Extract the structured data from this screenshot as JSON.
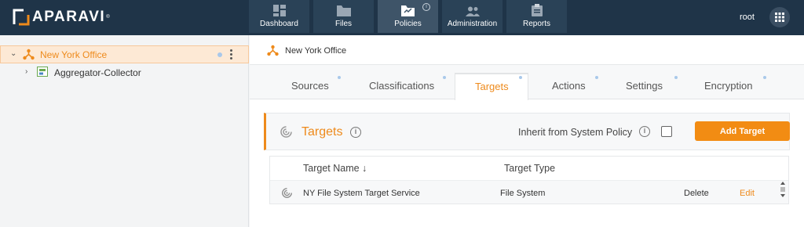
{
  "app": {
    "brand": "APARAVI",
    "brand_mark": "®"
  },
  "nav": [
    {
      "label": "Dashboard",
      "icon": "dashboard-icon"
    },
    {
      "label": "Files",
      "icon": "folder-icon"
    },
    {
      "label": "Policies",
      "icon": "policies-icon",
      "active": true,
      "info": "i"
    },
    {
      "label": "Administration",
      "icon": "users-icon"
    },
    {
      "label": "Reports",
      "icon": "clipboard-icon"
    }
  ],
  "user": {
    "name": "root"
  },
  "tree": {
    "root": {
      "label": "New York Office",
      "expanded": true,
      "selected": true
    },
    "child": {
      "label": "Aggregator-Collector",
      "expanded": false
    }
  },
  "breadcrumb": {
    "label": "New York Office"
  },
  "tabs": [
    {
      "label": "Sources"
    },
    {
      "label": "Classifications"
    },
    {
      "label": "Targets",
      "active": true
    },
    {
      "label": "Actions"
    },
    {
      "label": "Settings"
    },
    {
      "label": "Encryption"
    }
  ],
  "targets": {
    "title": "Targets",
    "info": "i",
    "inherit_label": "Inherit from System Policy",
    "inherit_checked": false,
    "add_button": "Add Target",
    "columns": {
      "name": "Target Name ↓",
      "type": "Target Type"
    },
    "rows": [
      {
        "name": "NY File System Target Service",
        "type": "File System",
        "delete": "Delete",
        "edit": "Edit"
      }
    ]
  },
  "colors": {
    "accent": "#ee8a1b",
    "topbar": "#1f3448",
    "button": "#f28c13"
  }
}
